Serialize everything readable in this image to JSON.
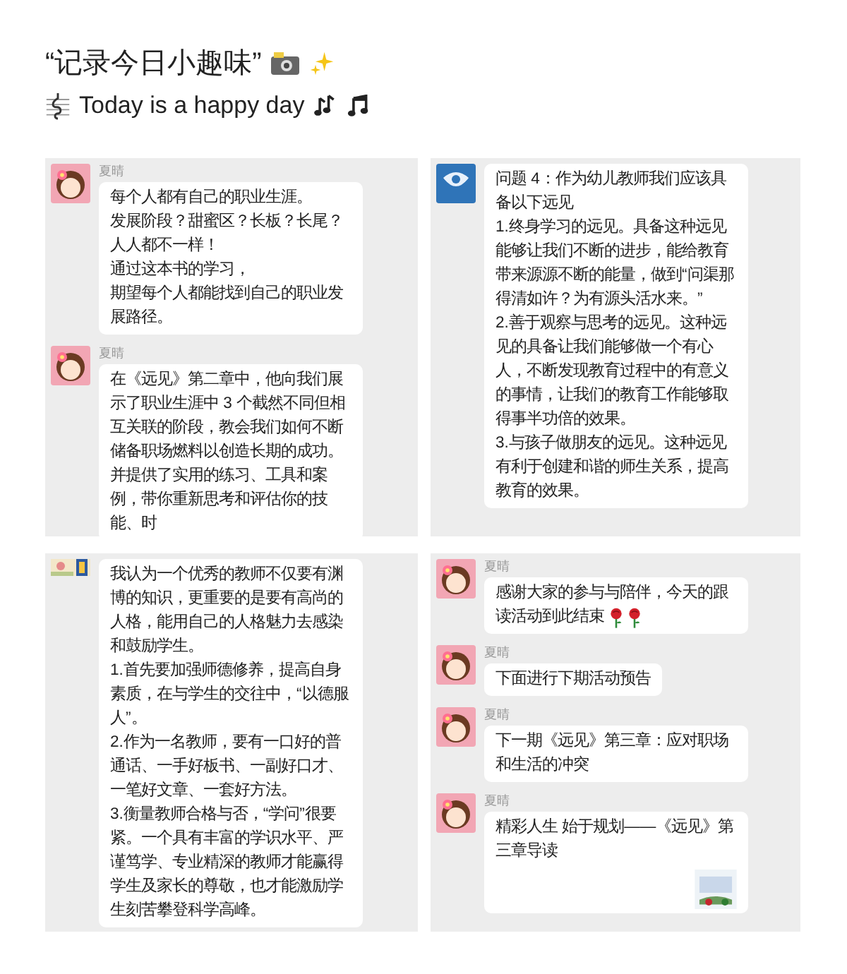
{
  "title": "“记录今日小趣味”",
  "subtitle": "Today is a happy day",
  "panels": [
    {
      "messages": [
        {
          "sender": "夏晴",
          "kind": "text",
          "paragraphs": [
            "每个人都有自己的职业生涯。",
            "发展阶段？甜蜜区？长板？长尾？",
            "人人都不一样！",
            "通过这本书的学习，",
            "期望每个人都能找到自己的职业发展路径。"
          ]
        },
        {
          "sender": "夏晴",
          "kind": "text",
          "paragraphs": [
            "在《远见》第二章中，他向我们展示了职业生涯中 3 个截然不同但相互关联的阶段，教会我们如何不断储备职场燃料以创造长期的成功。并提供了实用的练习、工具和案例，带你重新思考和评估你的技能、时"
          ]
        }
      ]
    },
    {
      "messages": [
        {
          "kind": "text",
          "paragraphs": [
            "问题 4：作为幼儿教师我们应该具备以下远见",
            "1.终身学习的远见。具备这种远见能够让我们不断的进步，能给教育带来源源不断的能量，做到“问渠那得清如许？为有源头活水来。”",
            "2.善于观察与思考的远见。这种远见的具备让我们能够做一个有心人，不断发现教育过程中的有意义的事情，让我们的教育工作能够取得事半功倍的效果。",
            "3.与孩子做朋友的远见。这种远见有利于创建和谐的师生关系，提高教育的效果。"
          ]
        }
      ]
    },
    {
      "messages": [
        {
          "kind": "text",
          "paragraphs": [
            "我认为一个优秀的教师不仅要有渊博的知识，更重要的是要有高尚的人格，能用自己的人格魅力去感染和鼓励学生。",
            "1.首先要加强师德修养，提高自身素质，在与学生的交往中，“以德服人”。",
            "2.作为一名教师，要有一口好的普通话、一手好板书、一副好口才、一笔好文章、一套好方法。",
            "3.衡量教师合格与否，“学问”很要紧。一个具有丰富的学识水平、严谨笃学、专业精深的教师才能赢得学生及家长的尊敬，也才能激励学生刻苦攀登科学高峰。"
          ]
        }
      ]
    },
    {
      "messages": [
        {
          "sender": "夏晴",
          "kind": "text",
          "paragraphs": [
            "感谢大家的参与与陪伴，今天的跟读活动到此结束"
          ],
          "roses": true
        },
        {
          "sender": "夏晴",
          "kind": "text",
          "paragraphs": [
            "下面进行下期活动预告"
          ]
        },
        {
          "sender": "夏晴",
          "kind": "text",
          "paragraphs": [
            "下一期《远见》第三章：应对职场和生活的冲突"
          ]
        },
        {
          "sender": "夏晴",
          "kind": "link",
          "paragraphs": [
            "精彩人生  始于规划——《远见》第三章导读"
          ]
        }
      ]
    }
  ]
}
